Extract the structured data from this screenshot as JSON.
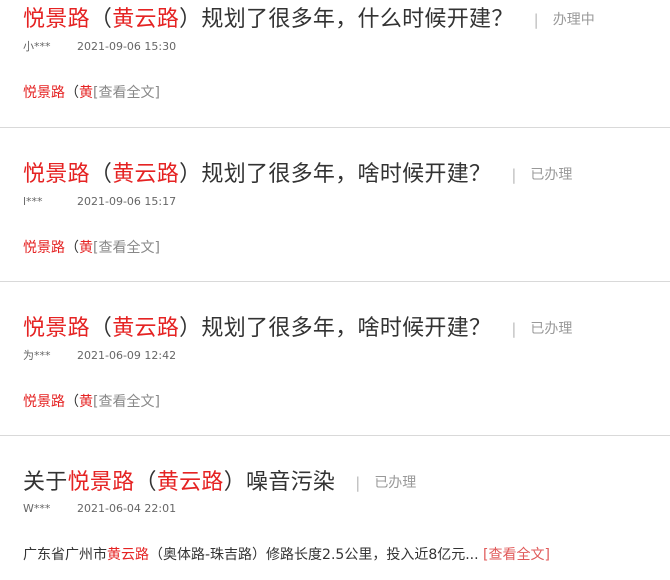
{
  "items": [
    {
      "title_parts": [
        "悦景路",
        "（",
        "黄云路",
        "）规划了很多年，什么时候开建？"
      ],
      "separator": "|",
      "status": "办理中",
      "user": "小***",
      "time": "2021-09-06 15:30",
      "snippet_parts": [
        "悦景路",
        "（",
        "黄"
      ],
      "more": "[查看全文]"
    },
    {
      "title_parts": [
        "悦景路",
        "（",
        "黄云路",
        "）规划了很多年，啥时候开建？"
      ],
      "separator": "|",
      "status": "已办理",
      "user": "l***",
      "time": "2021-09-06 15:17",
      "snippet_parts": [
        "悦景路",
        "（",
        "黄"
      ],
      "more": "[查看全文]"
    },
    {
      "title_parts": [
        "悦景路",
        "（",
        "黄云路",
        "）规划了很多年，啥时候开建？"
      ],
      "separator": "|",
      "status": "已办理",
      "user": "为***",
      "time": "2021-06-09 12:42",
      "snippet_parts": [
        "悦景路",
        "（",
        "黄"
      ],
      "more": "[查看全文]"
    },
    {
      "title_parts": [
        "关于",
        "悦景路",
        "（",
        "黄云路",
        "）噪音污染"
      ],
      "separator": "|",
      "status": "已办理",
      "user": "W***",
      "time": "2021-06-04 22:01",
      "snippet_parts": [
        "广东省广州市",
        "黄云路",
        "（奥体路-珠吉路）修路长度2.5公里，投入近8亿元..."
      ],
      "more": "[查看全文]"
    }
  ],
  "colors": {
    "highlight": "#e52323",
    "text": "#333333",
    "meta": "#666666",
    "status": "#999999",
    "divider": "#d9d9d9"
  }
}
